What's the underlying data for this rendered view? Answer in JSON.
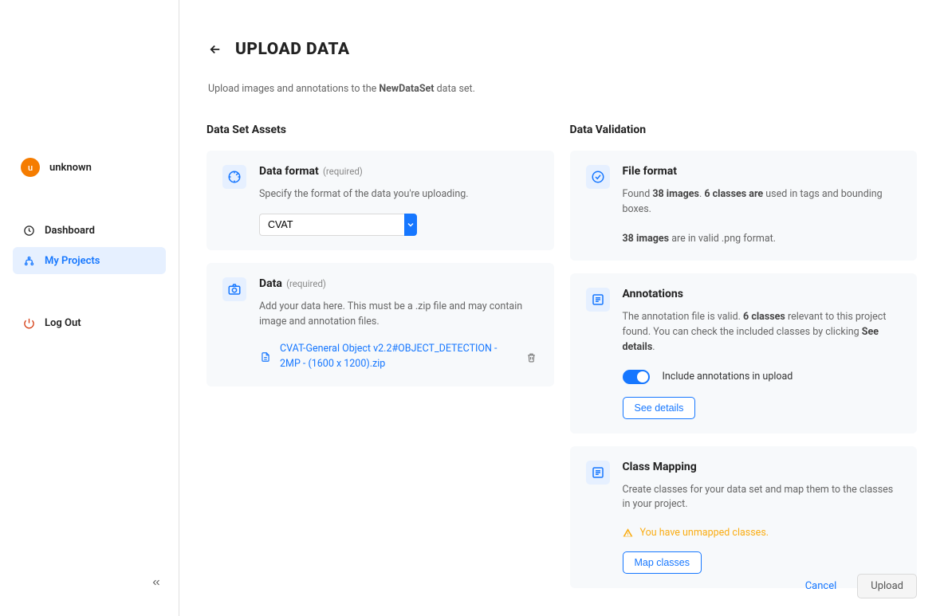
{
  "sidebar": {
    "user": {
      "avatar_letter": "u",
      "name": "unknown"
    },
    "items": [
      {
        "label": "Dashboard"
      },
      {
        "label": "My Projects"
      }
    ],
    "logout_label": "Log Out"
  },
  "header": {
    "title": "UPLOAD DATA",
    "desc_prefix": "Upload images and annotations to the ",
    "desc_bold": "NewDataSet",
    "desc_suffix": " data set."
  },
  "left": {
    "title": "Data Set Assets",
    "data_format": {
      "title": "Data format",
      "required": "(required)",
      "sub": "Specify the format of the data you're uploading.",
      "value": "CVAT"
    },
    "data": {
      "title": "Data",
      "required": "(required)",
      "sub": "Add your data here. This must be a .zip file and may contain image and annotation files.",
      "file_name": "CVAT-General Object v2.2#OBJECT_DETECTION - 2MP - (1600 x 1200).zip"
    }
  },
  "right": {
    "title": "Data Validation",
    "file_format": {
      "title": "File format",
      "line1_a": "Found ",
      "line1_b": "38 images",
      "line1_c": ". ",
      "line1_d": "6 classes are",
      "line1_e": " used in tags and bounding boxes.",
      "line2_a": "38 images",
      "line2_b": " are in valid .png format."
    },
    "annotations": {
      "title": "Annotations",
      "sub_a": "The annotation file is valid. ",
      "sub_b": "6 classes",
      "sub_c": " relevant to this project found. You can check the included classes by clicking ",
      "sub_d": "See details",
      "sub_e": ".",
      "toggle_label": "Include annotations in upload",
      "button": "See details"
    },
    "class_mapping": {
      "title": "Class Mapping",
      "sub": "Create classes for your data set and map them to the classes in your project.",
      "warning": "You have unmapped classes.",
      "button": "Map classes"
    }
  },
  "footer": {
    "cancel": "Cancel",
    "upload": "Upload"
  }
}
